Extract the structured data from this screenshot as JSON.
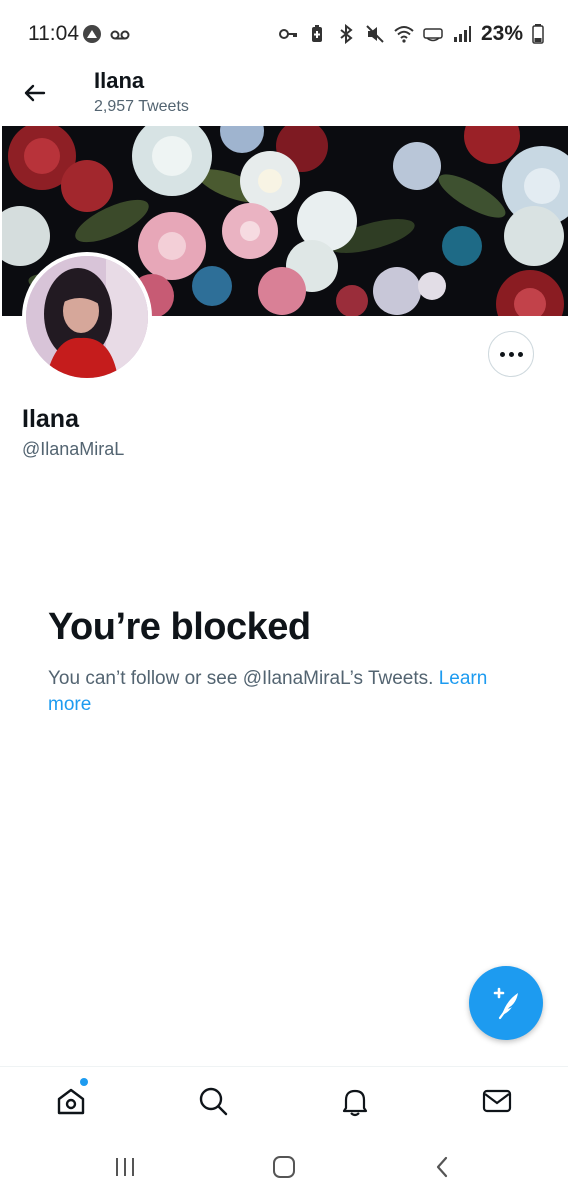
{
  "status_bar": {
    "time": "11:04",
    "battery": "23%",
    "icons_left": [
      "app-notification-icon",
      "voicemail-icon"
    ],
    "icons_right": [
      "vpn-key-icon",
      "battery-saver-icon",
      "bluetooth-icon",
      "mute-icon",
      "wifi-icon",
      "volte-icon",
      "signal-icon",
      "battery-icon"
    ]
  },
  "header": {
    "title": "Ilana",
    "subtitle": "2,957 Tweets"
  },
  "profile": {
    "name": "Ilana",
    "handle": "@IlanaMiraL"
  },
  "blocked": {
    "title": "You’re blocked",
    "message": "You can’t follow or see @IlanaMiraL’s Tweets.",
    "learn_more": "Learn more"
  },
  "tabs": [
    "home-icon",
    "search-icon",
    "notifications-icon",
    "messages-icon"
  ],
  "system_nav": [
    "recents-icon",
    "home-nav-icon",
    "back-nav-icon"
  ],
  "colors": {
    "accent": "#1d9bf0",
    "text_primary": "#0f1419",
    "text_secondary": "#536471",
    "banner_bg": "#0b0c10"
  }
}
